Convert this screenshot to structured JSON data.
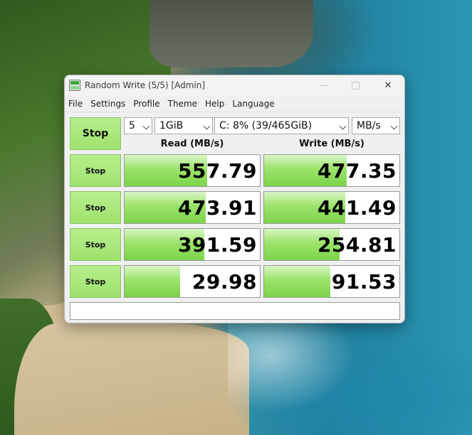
{
  "window": {
    "title": "Random Write (5/5) [Admin]"
  },
  "menu": {
    "items": [
      "File",
      "Settings",
      "Profile",
      "Theme",
      "Help",
      "Language"
    ]
  },
  "controls": {
    "main_button": "Stop",
    "count": "5",
    "size": "1GiB",
    "drive": "C: 8% (39/465GiB)",
    "unit": "MB/s"
  },
  "columns": {
    "read": "Read (MB/s)",
    "write": "Write (MB/s)"
  },
  "rows": [
    {
      "button": "Stop",
      "read": "557.79",
      "write": "477.35",
      "read_fill": 0.61,
      "write_fill": 0.61
    },
    {
      "button": "Stop",
      "read": "473.91",
      "write": "441.49",
      "read_fill": 0.6,
      "write_fill": 0.6
    },
    {
      "button": "Stop",
      "read": "391.59",
      "write": "254.81",
      "read_fill": 0.59,
      "write_fill": 0.56
    },
    {
      "button": "Stop",
      "read": "29.98",
      "write": "91.53",
      "read_fill": 0.41,
      "write_fill": 0.49
    }
  ],
  "status": "",
  "colors": {
    "accent_green": "#9ee26e",
    "fill_green": "#7cd44a"
  },
  "icons": {
    "app": "diskmark-icon",
    "close": "close-icon",
    "minimize": "minimize-icon",
    "maximize": "maximize-icon"
  }
}
